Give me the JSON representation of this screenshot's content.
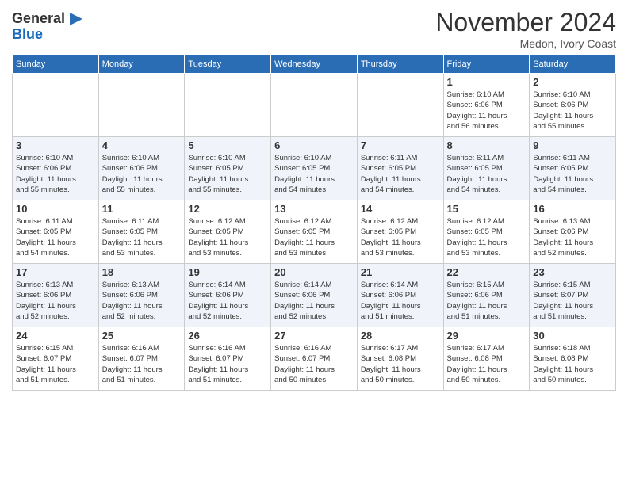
{
  "logo": {
    "general": "General",
    "blue": "Blue"
  },
  "header": {
    "month": "November 2024",
    "location": "Medon, Ivory Coast"
  },
  "weekdays": [
    "Sunday",
    "Monday",
    "Tuesday",
    "Wednesday",
    "Thursday",
    "Friday",
    "Saturday"
  ],
  "weeks": [
    [
      {
        "day": "",
        "info": ""
      },
      {
        "day": "",
        "info": ""
      },
      {
        "day": "",
        "info": ""
      },
      {
        "day": "",
        "info": ""
      },
      {
        "day": "",
        "info": ""
      },
      {
        "day": "1",
        "info": "Sunrise: 6:10 AM\nSunset: 6:06 PM\nDaylight: 11 hours\nand 56 minutes."
      },
      {
        "day": "2",
        "info": "Sunrise: 6:10 AM\nSunset: 6:06 PM\nDaylight: 11 hours\nand 55 minutes."
      }
    ],
    [
      {
        "day": "3",
        "info": "Sunrise: 6:10 AM\nSunset: 6:06 PM\nDaylight: 11 hours\nand 55 minutes."
      },
      {
        "day": "4",
        "info": "Sunrise: 6:10 AM\nSunset: 6:06 PM\nDaylight: 11 hours\nand 55 minutes."
      },
      {
        "day": "5",
        "info": "Sunrise: 6:10 AM\nSunset: 6:05 PM\nDaylight: 11 hours\nand 55 minutes."
      },
      {
        "day": "6",
        "info": "Sunrise: 6:10 AM\nSunset: 6:05 PM\nDaylight: 11 hours\nand 54 minutes."
      },
      {
        "day": "7",
        "info": "Sunrise: 6:11 AM\nSunset: 6:05 PM\nDaylight: 11 hours\nand 54 minutes."
      },
      {
        "day": "8",
        "info": "Sunrise: 6:11 AM\nSunset: 6:05 PM\nDaylight: 11 hours\nand 54 minutes."
      },
      {
        "day": "9",
        "info": "Sunrise: 6:11 AM\nSunset: 6:05 PM\nDaylight: 11 hours\nand 54 minutes."
      }
    ],
    [
      {
        "day": "10",
        "info": "Sunrise: 6:11 AM\nSunset: 6:05 PM\nDaylight: 11 hours\nand 54 minutes."
      },
      {
        "day": "11",
        "info": "Sunrise: 6:11 AM\nSunset: 6:05 PM\nDaylight: 11 hours\nand 53 minutes."
      },
      {
        "day": "12",
        "info": "Sunrise: 6:12 AM\nSunset: 6:05 PM\nDaylight: 11 hours\nand 53 minutes."
      },
      {
        "day": "13",
        "info": "Sunrise: 6:12 AM\nSunset: 6:05 PM\nDaylight: 11 hours\nand 53 minutes."
      },
      {
        "day": "14",
        "info": "Sunrise: 6:12 AM\nSunset: 6:05 PM\nDaylight: 11 hours\nand 53 minutes."
      },
      {
        "day": "15",
        "info": "Sunrise: 6:12 AM\nSunset: 6:05 PM\nDaylight: 11 hours\nand 53 minutes."
      },
      {
        "day": "16",
        "info": "Sunrise: 6:13 AM\nSunset: 6:06 PM\nDaylight: 11 hours\nand 52 minutes."
      }
    ],
    [
      {
        "day": "17",
        "info": "Sunrise: 6:13 AM\nSunset: 6:06 PM\nDaylight: 11 hours\nand 52 minutes."
      },
      {
        "day": "18",
        "info": "Sunrise: 6:13 AM\nSunset: 6:06 PM\nDaylight: 11 hours\nand 52 minutes."
      },
      {
        "day": "19",
        "info": "Sunrise: 6:14 AM\nSunset: 6:06 PM\nDaylight: 11 hours\nand 52 minutes."
      },
      {
        "day": "20",
        "info": "Sunrise: 6:14 AM\nSunset: 6:06 PM\nDaylight: 11 hours\nand 52 minutes."
      },
      {
        "day": "21",
        "info": "Sunrise: 6:14 AM\nSunset: 6:06 PM\nDaylight: 11 hours\nand 51 minutes."
      },
      {
        "day": "22",
        "info": "Sunrise: 6:15 AM\nSunset: 6:06 PM\nDaylight: 11 hours\nand 51 minutes."
      },
      {
        "day": "23",
        "info": "Sunrise: 6:15 AM\nSunset: 6:07 PM\nDaylight: 11 hours\nand 51 minutes."
      }
    ],
    [
      {
        "day": "24",
        "info": "Sunrise: 6:15 AM\nSunset: 6:07 PM\nDaylight: 11 hours\nand 51 minutes."
      },
      {
        "day": "25",
        "info": "Sunrise: 6:16 AM\nSunset: 6:07 PM\nDaylight: 11 hours\nand 51 minutes."
      },
      {
        "day": "26",
        "info": "Sunrise: 6:16 AM\nSunset: 6:07 PM\nDaylight: 11 hours\nand 51 minutes."
      },
      {
        "day": "27",
        "info": "Sunrise: 6:16 AM\nSunset: 6:07 PM\nDaylight: 11 hours\nand 50 minutes."
      },
      {
        "day": "28",
        "info": "Sunrise: 6:17 AM\nSunset: 6:08 PM\nDaylight: 11 hours\nand 50 minutes."
      },
      {
        "day": "29",
        "info": "Sunrise: 6:17 AM\nSunset: 6:08 PM\nDaylight: 11 hours\nand 50 minutes."
      },
      {
        "day": "30",
        "info": "Sunrise: 6:18 AM\nSunset: 6:08 PM\nDaylight: 11 hours\nand 50 minutes."
      }
    ]
  ]
}
